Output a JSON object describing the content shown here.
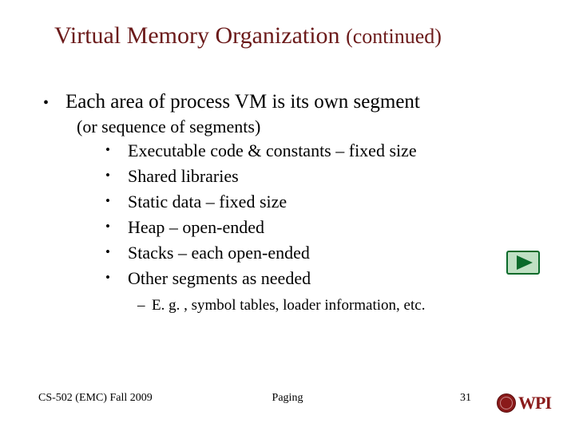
{
  "title": {
    "main": "Virtual Memory Organization ",
    "sub": "(continued)"
  },
  "bullets": {
    "l1": "Each area of process VM is its own segment",
    "paren": "(or sequence of segments)",
    "l2": [
      "Executable code & constants – fixed size",
      "Shared libraries",
      "Static data – fixed size",
      "Heap – open-ended",
      "Stacks – each open-ended",
      "Other segments as needed"
    ],
    "l3": "E. g. , symbol tables, loader information, etc."
  },
  "footer": {
    "left": "CS-502 (EMC) Fall 2009",
    "center": "Paging",
    "page": "31",
    "brand": "WPI"
  },
  "icons": {
    "play": "play-icon"
  }
}
